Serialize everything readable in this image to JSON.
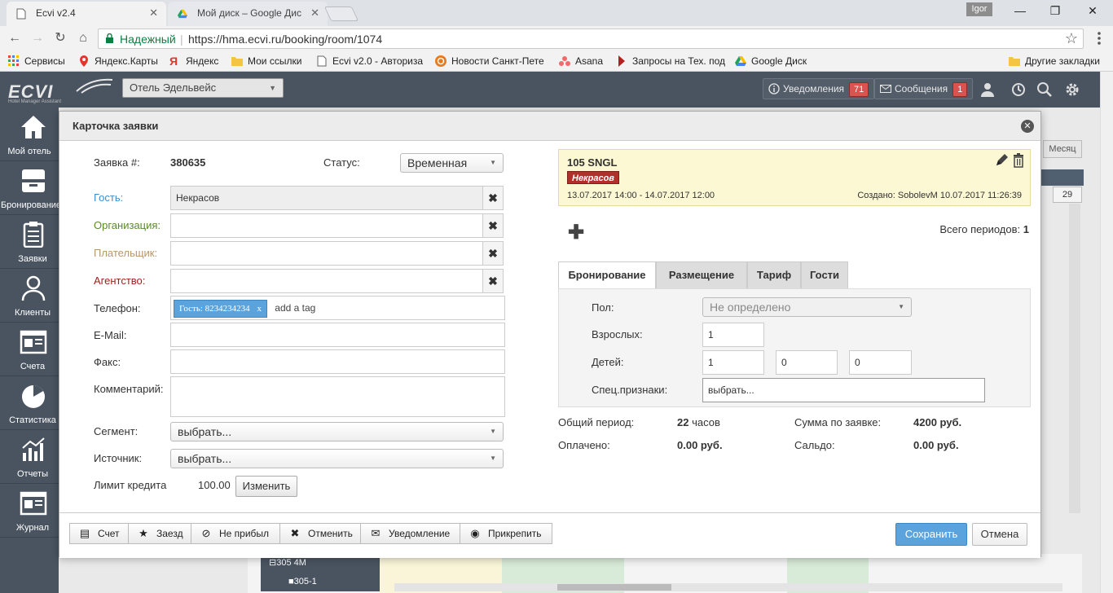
{
  "browser": {
    "tabs": [
      {
        "title": "Ecvi v2.4"
      },
      {
        "title": "Мой диск – Google Дис"
      }
    ],
    "user": "Igor",
    "secure_label": "Надежный",
    "url": "https://hma.ecvi.ru/booking/room/1074",
    "bookmarks": [
      {
        "label": "Сервисы"
      },
      {
        "label": "Яндекс.Карты"
      },
      {
        "label": "Яндекс"
      },
      {
        "label": "Мои ссылки"
      },
      {
        "label": "Ecvi v2.0 - Авториза"
      },
      {
        "label": "Новости Санкт-Пете"
      },
      {
        "label": "Asana"
      },
      {
        "label": "Запросы на Тех. под"
      },
      {
        "label": "Google Диск"
      },
      {
        "label": "Другие закладки"
      }
    ]
  },
  "app": {
    "logo_text": "ECVI",
    "logo_subtext": "Hotel Manager Assistant",
    "hotel": "Отель Эдельвейс",
    "notifications_label": "Уведомления",
    "notifications_count": "71",
    "messages_label": "Сообщения",
    "messages_count": "1",
    "sidebar": [
      {
        "label": "Мой отель"
      },
      {
        "label": "Бронирование"
      },
      {
        "label": "Заявки"
      },
      {
        "label": "Клиенты"
      },
      {
        "label": "Счета"
      },
      {
        "label": "Статистика"
      },
      {
        "label": "Отчеты"
      },
      {
        "label": "Журнал"
      }
    ],
    "bg": {
      "month_button": "Месяц",
      "day": "29",
      "room_group": "305 4М",
      "room_item": "305-1"
    }
  },
  "modal": {
    "title": "Карточка заявки",
    "order_label": "Заявка #:",
    "order_number": "380635",
    "status_label": "Статус:",
    "status_value": "Временная",
    "guest_label": "Гость:",
    "guest_value": "Некрасов",
    "org_label": "Организация:",
    "payer_label": "Плательщик:",
    "agency_label": "Агентство:",
    "phone_label": "Телефон:",
    "phone_tag": "Гость: 8234234234",
    "phone_placeholder": "add a tag",
    "email_label": "E-Mail:",
    "fax_label": "Факс:",
    "comment_label": "Комментарий:",
    "segment_label": "Сегмент:",
    "segment_value": "выбрать...",
    "source_label": "Источник:",
    "source_value": "выбрать...",
    "credit_label": "Лимит кредита",
    "credit_value": "100.00",
    "change_button": "Изменить",
    "colors": {
      "guest": "#3b8fd0",
      "org": "#5a8a2a",
      "payer": "#b8966a",
      "agency": "#a32020"
    }
  },
  "booking": {
    "room": "105 SNGL",
    "guest_badge": "Некрасов",
    "period": "13.07.2017 14:00 - 14.07.2017 12:00",
    "created": "Создано: SobolevM 10.07.2017 11:26:39",
    "total_periods_label": "Всего периодов:",
    "total_periods": "1",
    "tabs": [
      {
        "label": "Бронирование"
      },
      {
        "label": "Размещение"
      },
      {
        "label": "Тариф"
      },
      {
        "label": "Гости"
      }
    ],
    "gender_label": "Пол:",
    "gender_value": "Не определено",
    "adults_label": "Взрослых:",
    "adults_value": "1",
    "children_label": "Детей:",
    "children_values": [
      "1",
      "0",
      "0"
    ],
    "special_label": "Спец.признаки:",
    "special_value": "выбрать...",
    "summary": {
      "total_period_label": "Общий период:",
      "total_period_value": "22",
      "total_period_unit": "часов",
      "sum_label": "Сумма по заявке:",
      "sum_value": "4200 руб.",
      "paid_label": "Оплачено:",
      "paid_value": "0.00 руб.",
      "balance_label": "Сальдо:",
      "balance_value": "0.00 руб."
    }
  },
  "footer": {
    "buttons": [
      {
        "label": "Счет"
      },
      {
        "label": "Заезд"
      },
      {
        "label": "Не прибыл"
      },
      {
        "label": "Отменить"
      },
      {
        "label": "Уведомление"
      },
      {
        "label": "Прикрепить"
      }
    ],
    "save": "Сохранить",
    "cancel": "Отмена"
  }
}
